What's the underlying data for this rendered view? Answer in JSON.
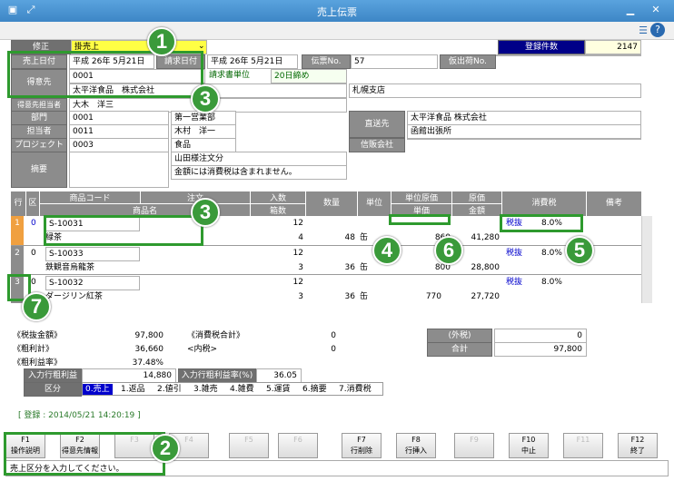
{
  "window": {
    "title": "売上伝票"
  },
  "header": {
    "mode_label": "修正",
    "mode_value": "掛売上",
    "count_label": "登録件数",
    "count_value": "2147",
    "sales_date_label": "売上日付",
    "sales_date_value": "平成 26年 5月21日",
    "billing_date_label": "請求日付",
    "billing_date_value": "平成 26年 5月21日",
    "slip_no_label": "伝票No.",
    "slip_no_value": "57",
    "temp_ship_label": "仮出荷No."
  },
  "customer": {
    "label": "得意先",
    "code": "0001",
    "unit_label": "請求書単位",
    "closing": "20日締め",
    "name": "太平洋食品　株式会社",
    "branch": "札幌支店",
    "contact_label": "得意先担当者",
    "contact_value": "大木　洋三"
  },
  "dept": {
    "label": "部門",
    "code": "0001",
    "name": "第一営業部"
  },
  "staff": {
    "label": "担当者",
    "code": "0011",
    "name": "木村　洋一"
  },
  "project": {
    "label": "プロジェクト",
    "code": "0003",
    "name": "食品"
  },
  "memo": {
    "label": "摘要",
    "line1": "山田様注文分",
    "line2": "金額には消費税は含まれません。"
  },
  "delivery": {
    "label": "直送先",
    "name": "太平洋食品 株式会社",
    "branch": "函館出張所"
  },
  "consignment": {
    "label": "信販会社"
  },
  "grid": {
    "headers": {
      "row": "行",
      "kubun": "区",
      "code": "商品コード",
      "order": "注文",
      "name": "商品名",
      "irisu": "入数",
      "hakosu": "箱数",
      "qty": "数量",
      "unit": "単位",
      "unit_cost": "単位原価",
      "unit_price": "単価",
      "cost": "原価",
      "amount": "金額",
      "tax": "消費税",
      "note": "備考"
    },
    "rows": [
      {
        "no": "1",
        "kubun": "0",
        "code": "S-10031",
        "name": "緑茶",
        "irisu": "12",
        "hakosu": "4",
        "qty": "48",
        "unit": "缶",
        "unit_cost": "",
        "unit_price": "860",
        "cost": "",
        "amount": "41,280",
        "tax_type": "税抜",
        "tax_rate": "8.0%"
      },
      {
        "no": "2",
        "kubun": "0",
        "code": "S-10033",
        "name": "鉄観音烏龍茶",
        "irisu": "12",
        "hakosu": "3",
        "qty": "36",
        "unit": "缶",
        "unit_cost": "",
        "unit_price": "800",
        "cost": "",
        "amount": "28,800",
        "tax_type": "税抜",
        "tax_rate": "8.0%"
      },
      {
        "no": "3",
        "kubun": "0",
        "code": "S-10032",
        "name": "ダージリン紅茶",
        "irisu": "12",
        "hakosu": "3",
        "qty": "36",
        "unit": "缶",
        "unit_cost": "",
        "unit_price": "770",
        "cost": "27,720",
        "amount": "",
        "tax_type": "税抜",
        "tax_rate": "8.0%"
      }
    ]
  },
  "totals": {
    "pretax_label": "《税抜金額》",
    "pretax_value": "97,800",
    "tax_total_label": "《消費税合計》",
    "tax_total_value": "0",
    "gross_label": "《粗利計》",
    "gross_value": "36,660",
    "incl_label": "<内税>",
    "incl_value": "0",
    "margin_label": "《粗利益率》",
    "margin_value": "37.48%",
    "ext_label": "(外税)",
    "ext_value": "0",
    "sum_label": "合計",
    "sum_value": "97,800",
    "input_gross_label": "入力行粗利益",
    "input_gross_value": "14,880",
    "input_rate_label": "入力行粗利益率(%)",
    "input_rate_value": "36.05"
  },
  "kubun_bar": {
    "label": "区分",
    "options": [
      "0.売上",
      "1.返品",
      "2.値引",
      "3.雑売",
      "4.雑費",
      "5.運賃",
      "6.摘要",
      "7.消費税"
    ]
  },
  "registration": "[ 登録 :  2014/05/21 14:20:19 ]",
  "fkeys": [
    {
      "key": "F1",
      "label": "操作説明",
      "enabled": true
    },
    {
      "key": "F2",
      "label": "得意先情報",
      "enabled": true
    },
    {
      "key": "F3",
      "label": "",
      "enabled": false
    },
    {
      "key": "F4",
      "label": "",
      "enabled": false
    },
    {
      "key": "F5",
      "label": "",
      "enabled": false
    },
    {
      "key": "F6",
      "label": "",
      "enabled": false
    },
    {
      "key": "F7",
      "label": "行削除",
      "enabled": true
    },
    {
      "key": "F8",
      "label": "行挿入",
      "enabled": true
    },
    {
      "key": "F9",
      "label": "",
      "enabled": false
    },
    {
      "key": "F10",
      "label": "中止",
      "enabled": true
    },
    {
      "key": "F11",
      "label": "",
      "enabled": false
    },
    {
      "key": "F12",
      "label": "終了",
      "enabled": true
    }
  ],
  "status": "売上区分を入力してください。",
  "callouts": [
    "1",
    "2",
    "3",
    "3",
    "4",
    "5",
    "6",
    "7"
  ],
  "colors": {
    "titlebar": "#4a95d4",
    "label_bg": "#8c8c8c",
    "callout": "#3a9a3a",
    "kubun_selected": "#0000cc",
    "count_label_bg": "#000088"
  }
}
